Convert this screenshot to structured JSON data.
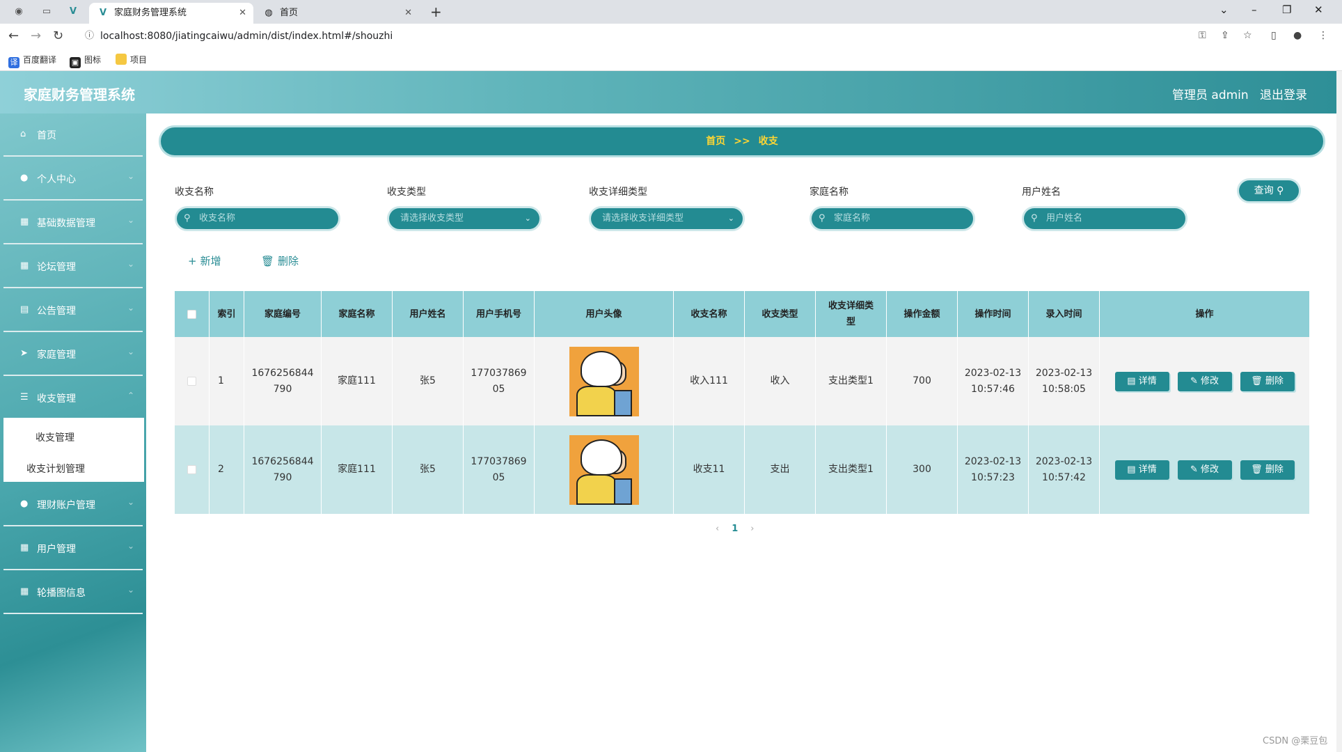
{
  "browser": {
    "tabs": [
      {
        "title": "家庭财务管理系统",
        "active": true
      },
      {
        "title": "首页",
        "active": false
      }
    ],
    "url": "localhost:8080/jiatingcaiwu/admin/dist/index.html#/shouzhi",
    "bookmarks": [
      "百度翻译",
      "图标",
      "项目"
    ]
  },
  "header": {
    "title": "家庭财务管理系统",
    "admin": "管理员 admin",
    "logout": "退出登录"
  },
  "sidebar": {
    "items": [
      {
        "label": "首页",
        "icon": "home-icon"
      },
      {
        "label": "个人中心",
        "icon": "user-icon"
      },
      {
        "label": "基础数据管理",
        "icon": "database-icon"
      },
      {
        "label": "论坛管理",
        "icon": "grid-icon"
      },
      {
        "label": "公告管理",
        "icon": "notice-icon"
      },
      {
        "label": "家庭管理",
        "icon": "send-icon"
      },
      {
        "label": "收支管理",
        "icon": "sliders-icon"
      },
      {
        "label": "理财账户管理",
        "icon": "pin-icon"
      },
      {
        "label": "用户管理",
        "icon": "grid-icon"
      },
      {
        "label": "轮播图信息",
        "icon": "grid-icon"
      }
    ],
    "submenu": [
      "收支管理",
      "收支计划管理"
    ]
  },
  "breadcrumb": {
    "home": "首页",
    "sep": ">>",
    "current": "收支"
  },
  "filters": [
    {
      "label": "收支名称",
      "placeholder": "收支名称",
      "type": "input"
    },
    {
      "label": "收支类型",
      "placeholder": "请选择收支类型",
      "type": "select"
    },
    {
      "label": "收支详细类型",
      "placeholder": "请选择收支详细类型",
      "type": "select"
    },
    {
      "label": "家庭名称",
      "placeholder": "家庭名称",
      "type": "input"
    },
    {
      "label": "用户姓名",
      "placeholder": "用户姓名",
      "type": "input"
    }
  ],
  "query_label": "查询",
  "actions": {
    "add": "新增",
    "delete": "删除"
  },
  "table": {
    "columns": [
      "索引",
      "家庭编号",
      "家庭名称",
      "用户姓名",
      "用户手机号",
      "用户头像",
      "收支名称",
      "收支类型",
      "收支详细类型",
      "操作金额",
      "操作时间",
      "录入时间",
      "操作"
    ],
    "rows": [
      {
        "index": "1",
        "family_no_1": "1676256844",
        "family_no_2": "790",
        "family_name": "家庭111",
        "user_name": "张5",
        "phone_1": "177037869",
        "phone_2": "05",
        "item_name": "收入111",
        "type": "收入",
        "detail_type": "支出类型1",
        "amount": "700",
        "op_date": "2023-02-13",
        "op_time": "10:57:46",
        "in_date": "2023-02-13",
        "in_time": "10:58:05"
      },
      {
        "index": "2",
        "family_no_1": "1676256844",
        "family_no_2": "790",
        "family_name": "家庭111",
        "user_name": "张5",
        "phone_1": "177037869",
        "phone_2": "05",
        "item_name": "收支11",
        "type": "支出",
        "detail_type": "支出类型1",
        "amount": "300",
        "op_date": "2023-02-13",
        "op_time": "10:57:23",
        "in_date": "2023-02-13",
        "in_time": "10:57:42"
      }
    ],
    "ops": {
      "detail": "详情",
      "edit": "修改",
      "delete": "删除"
    }
  },
  "pager": {
    "current": "1"
  },
  "watermark": "CSDN @栗豆包",
  "colors": {
    "primary": "#238b92",
    "header_light": "#8fd0d8",
    "accent_text": "#ffd633"
  }
}
